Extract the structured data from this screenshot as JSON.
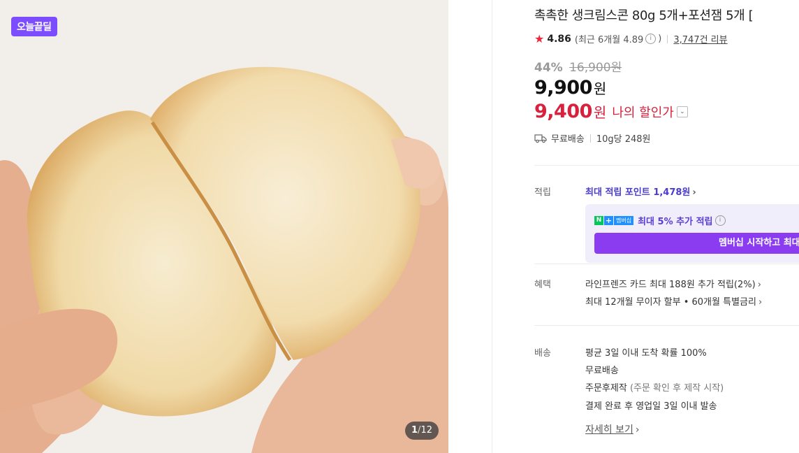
{
  "gallery": {
    "badge": "오늘끝딜",
    "counter_current": "1",
    "counter_sep": "/",
    "counter_total": "12"
  },
  "product": {
    "title": "촉촉한 생크림스콘 80g 5개+포션잼 5개 [",
    "rating_score": "4.86",
    "rating_recent": "(최근 6개월 4.89",
    "rating_recent_close": ")",
    "review_count": "3,747건 리뷰",
    "discount_rate": "44%",
    "original_price": "16,900원",
    "sale_price": "9,900",
    "sale_won": "원",
    "my_price": "9,400",
    "my_won": "원",
    "my_price_label": "나의 할인가",
    "shipping_free": "무료배송",
    "unit_price": "10g당 248원"
  },
  "points": {
    "label": "적립",
    "max_text": "최대 적립 포인트 ",
    "max_amount": "1,478원",
    "npay_n": "N",
    "npay_plus": "+",
    "npay_member": "멤버십",
    "member_text": "최대 5% 추가 적립",
    "member_button": "멤버십 시작하고 최대"
  },
  "benefits": {
    "label": "혜택",
    "items": [
      "라인프렌즈 카드 최대 188원 추가 적립(2%)",
      "최대 12개월 무이자 할부 • 60개월 특별금리"
    ]
  },
  "delivery": {
    "label": "배송",
    "line1": "평균 3일 이내 도착 확률 100%",
    "line2": "무료배송",
    "line3_main": "주문후제작 ",
    "line3_sub": "(주문 확인 후 제작 시작)",
    "line4": "결제 완료 후 영업일 3일 이내 발송",
    "detail_link": "자세히 보기"
  },
  "colors": {
    "accent_purple": "#7b4dff",
    "sale_red": "#d8213c",
    "member_button": "#8b3cf0",
    "npay_green": "#03c75a"
  }
}
